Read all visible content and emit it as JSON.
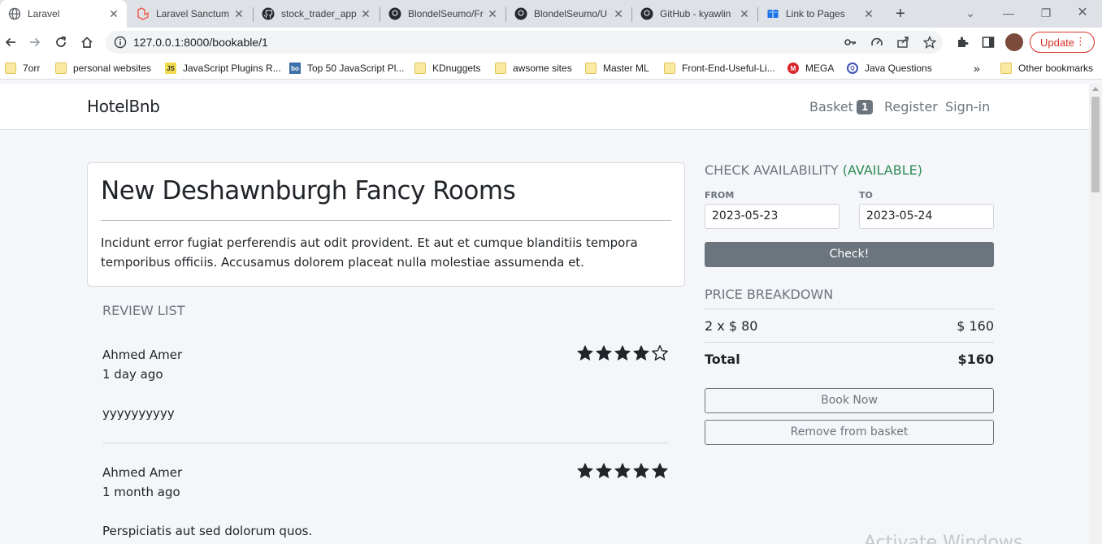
{
  "browser": {
    "tabs": [
      {
        "title": "Laravel",
        "icon": "globe-icon",
        "active": true
      },
      {
        "title": "Laravel Sanctum",
        "icon": "laravel-icon"
      },
      {
        "title": "stock_trader_app",
        "icon": "github-icon"
      },
      {
        "title": "BlondelSeumo/Fr",
        "icon": "github-icon"
      },
      {
        "title": "BlondelSeumo/U",
        "icon": "github-icon"
      },
      {
        "title": "GitHub - kyawlin",
        "icon": "github-icon"
      },
      {
        "title": "Link to Pages",
        "icon": "book-icon"
      }
    ],
    "url": "127.0.0.1:8000/bookable/1",
    "update_label": "Update",
    "bookmarks": [
      {
        "label": "7orr",
        "icon": "folder-icon"
      },
      {
        "label": "personal websites",
        "icon": "folder-icon"
      },
      {
        "label": "JavaScript Plugins R...",
        "icon": "js-icon",
        "badge": "JS"
      },
      {
        "label": "Top 50 JavaScript Pl...",
        "icon": "bo-icon",
        "badge": "bo"
      },
      {
        "label": "KDnuggets",
        "icon": "folder-icon"
      },
      {
        "label": "awsome sites",
        "icon": "folder-icon"
      },
      {
        "label": "Master ML",
        "icon": "folder-icon"
      },
      {
        "label": "Front-End-Useful-Li...",
        "icon": "folder-icon"
      },
      {
        "label": "MEGA",
        "icon": "mega-icon",
        "badge": "M"
      },
      {
        "label": "Java Questions",
        "icon": "q-icon",
        "badge": "Q"
      }
    ],
    "other_bookmarks": "Other bookmarks",
    "overflow": "»"
  },
  "navbar": {
    "brand": "HotelBnb",
    "basket_label": "Basket",
    "basket_count": "1",
    "register": "Register",
    "signin": "Sign-in"
  },
  "bookable": {
    "title": "New Deshawnburgh Fancy Rooms",
    "description": "Incidunt error fugiat perferendis aut odit provident. Et aut et cumque blanditiis tempora temporibus officiis. Accusamus dolorem placeat nulla molestiae assumenda et."
  },
  "reviews": {
    "heading": "REVIEW LIST",
    "items": [
      {
        "author": "Ahmed Amer",
        "time": "1 day ago",
        "content": "yyyyyyyyyy",
        "rating": 4
      },
      {
        "author": "Ahmed Amer",
        "time": "1 month ago",
        "content": "Perspiciatis aut sed dolorum quos.",
        "rating": 5
      }
    ]
  },
  "availability": {
    "heading": "CHECK AVAILABILITY",
    "status": "(AVAILABLE)",
    "from_label": "FROM",
    "to_label": "TO",
    "from": "2023-05-23",
    "to": "2023-05-24",
    "check_button": "Check!",
    "status_color": "#2e8b57"
  },
  "price": {
    "heading": "PRICE BREAKDOWN",
    "line_label": "2 x $ 80",
    "line_value": "$ 160",
    "total_label": "Total",
    "total_value": "$160"
  },
  "actions": {
    "book_now": "Book Now",
    "remove": "Remove from basket"
  },
  "watermark": "Activate Windows"
}
